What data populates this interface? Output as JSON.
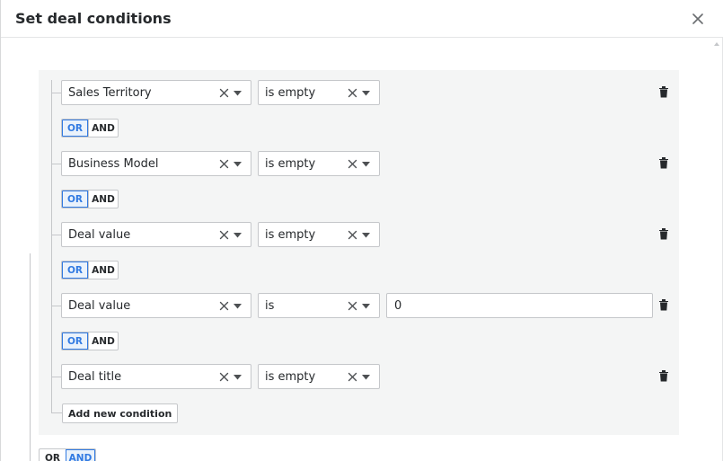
{
  "modal": {
    "title": "Set deal conditions"
  },
  "conditions": [
    {
      "field": "Sales Territory",
      "operator": "is empty"
    },
    {
      "field": "Business Model",
      "operator": "is empty"
    },
    {
      "field": "Deal value",
      "operator": "is empty"
    },
    {
      "field": "Deal value",
      "operator": "is",
      "value": "0"
    },
    {
      "field": "Deal title",
      "operator": "is empty"
    }
  ],
  "logic": {
    "or_label": "OR",
    "and_label": "AND",
    "inner_active": "OR",
    "outer_active": "AND"
  },
  "actions": {
    "add_condition_label": "Add new condition"
  },
  "colors": {
    "accent": "#317ae2",
    "group_bg": "#f4f5f5",
    "border": "#c5c7ca"
  },
  "icons": {
    "close": "close-icon",
    "clear": "clear-icon",
    "caret": "chevron-down-icon",
    "delete": "trash-icon"
  }
}
